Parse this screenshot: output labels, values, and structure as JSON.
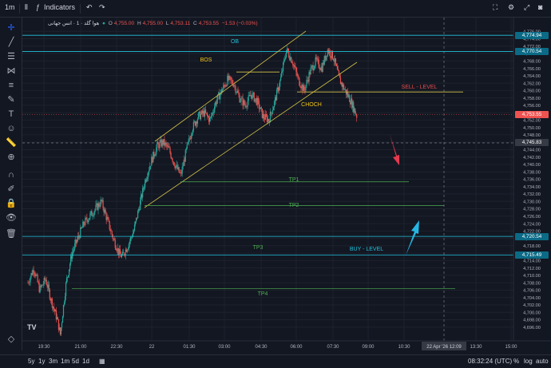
{
  "toolbar": {
    "timeframe": "1m",
    "indicators_label": "Indicators"
  },
  "legend": {
    "symbol": "هوا گلد · 1 · انس جهانی",
    "open_label": "O",
    "open_value": "4,755.00",
    "high_label": "H",
    "high_value": "4,755.00",
    "low_label": "L",
    "low_value": "4,753.11",
    "close_label": "C",
    "close_value": "4,753.55",
    "change": "−1.53 (−0.03%)"
  },
  "bottom": {
    "ranges": [
      "5y",
      "1y",
      "3m",
      "1m",
      "5d",
      "1d"
    ],
    "clock": "08:32:24 (UTC)",
    "percent_label": "%",
    "log_label": "log",
    "auto_label": "auto"
  },
  "colors": {
    "background": "#131722",
    "grid": "#1e222d",
    "up_candle": "#26a69a",
    "down_candle": "#ef5350",
    "cyan_line": "#22c3dd",
    "channel": "#d4c247",
    "tp_line": "#4caf50",
    "sell_arrow": "#e53950",
    "buy_arrow": "#26b6e3"
  },
  "chart_data": {
    "type": "candlestick",
    "ylim": [
      4694,
      4778
    ],
    "y_ticks": [
      "4,776.00",
      "4,774.00",
      "4,772.00",
      "4,770.00",
      "4,768.00",
      "4,766.00",
      "4,764.00",
      "4,762.00",
      "4,760.00",
      "4,758.00",
      "4,756.00",
      "4,754.00",
      "4,752.00",
      "4,750.00",
      "4,748.00",
      "4,746.00",
      "4,744.00",
      "4,742.00",
      "4,740.00",
      "4,738.00",
      "4,736.00",
      "4,734.00",
      "4,732.00",
      "4,730.00",
      "4,728.00",
      "4,726.00",
      "4,724.00",
      "4,722.00",
      "4,720.00",
      "4,718.00",
      "4,716.00",
      "4,714.00",
      "4,712.00",
      "4,710.00",
      "4,708.00",
      "4,706.00",
      "4,704.00",
      "4,702.00",
      "4,700.00",
      "4,698.00",
      "4,696.00"
    ],
    "x_ticks": [
      "19:30",
      "21:00",
      "22:30",
      "22",
      "01:30",
      "03:00",
      "04:30",
      "06:00",
      "07:30",
      "09:00",
      "10:30",
      "13:30",
      "15:00"
    ],
    "x_cursor_label": "22 Apr '26  12:09",
    "price_markers": [
      {
        "label": "4,774.94",
        "value": 4774.94,
        "kind": "line"
      },
      {
        "label": "4,770.54",
        "value": 4770.54,
        "kind": "line"
      },
      {
        "label": "4,753.55",
        "value": 4753.55,
        "kind": "last"
      },
      {
        "label": "4,745.83",
        "value": 4745.83,
        "kind": "cursor"
      },
      {
        "label": "4,720.54",
        "value": 4720.54,
        "kind": "line"
      },
      {
        "label": "4,715.49",
        "value": 4715.49,
        "kind": "line"
      }
    ],
    "price_path": [
      [
        0,
        4708
      ],
      [
        4,
        4712
      ],
      [
        8,
        4706
      ],
      [
        12,
        4709
      ],
      [
        16,
        4703
      ],
      [
        20,
        4698
      ],
      [
        22,
        4694
      ],
      [
        26,
        4708
      ],
      [
        30,
        4716
      ],
      [
        34,
        4720
      ],
      [
        38,
        4724
      ],
      [
        42,
        4726
      ],
      [
        46,
        4728
      ],
      [
        50,
        4730
      ],
      [
        54,
        4725
      ],
      [
        58,
        4720
      ],
      [
        62,
        4716
      ],
      [
        64,
        4715
      ],
      [
        68,
        4718
      ],
      [
        72,
        4722
      ],
      [
        76,
        4729
      ],
      [
        80,
        4736
      ],
      [
        84,
        4741
      ],
      [
        88,
        4745
      ],
      [
        92,
        4746
      ],
      [
        96,
        4744
      ],
      [
        100,
        4740
      ],
      [
        104,
        4737
      ],
      [
        108,
        4744
      ],
      [
        112,
        4750
      ],
      [
        116,
        4753
      ],
      [
        120,
        4754
      ],
      [
        124,
        4752
      ],
      [
        128,
        4757
      ],
      [
        132,
        4760
      ],
      [
        136,
        4763
      ],
      [
        140,
        4762
      ],
      [
        144,
        4758
      ],
      [
        148,
        4756
      ],
      [
        152,
        4759
      ],
      [
        156,
        4757
      ],
      [
        160,
        4753
      ],
      [
        164,
        4752
      ],
      [
        168,
        4757
      ],
      [
        172,
        4763
      ],
      [
        176,
        4771
      ],
      [
        180,
        4768
      ],
      [
        184,
        4763
      ],
      [
        188,
        4760
      ],
      [
        192,
        4765
      ],
      [
        196,
        4768
      ],
      [
        200,
        4766
      ],
      [
        204,
        4771
      ],
      [
        208,
        4769
      ],
      [
        212,
        4763
      ],
      [
        216,
        4760
      ],
      [
        220,
        4757
      ],
      [
        224,
        4753
      ]
    ],
    "annotations": {
      "ob": "OB",
      "bos": "BOS",
      "choch": "CHOCH",
      "sell_level": "SELL - LEVEL",
      "buy_level": "BUY - LEVEL",
      "tp1": "TP1",
      "tp2": "TP2",
      "tp3": "TP3",
      "tp4": "TP4"
    },
    "levels": {
      "sell_level": 4759.6,
      "bos": 4765.0,
      "tp1": 4735.3,
      "tp2": 4728.9,
      "tp4": 4706.4
    },
    "grid": true
  }
}
